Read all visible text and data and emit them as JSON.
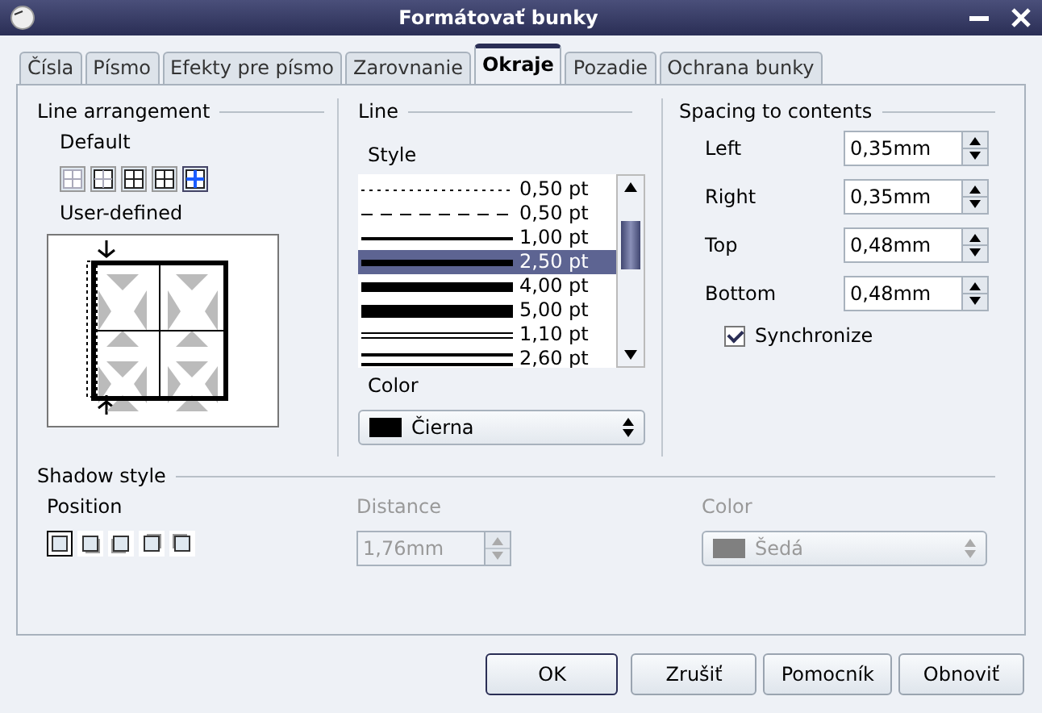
{
  "window": {
    "title": "Formátovať bunky"
  },
  "tabs": [
    {
      "label": "Čísla",
      "selected": false
    },
    {
      "label": "Písmo",
      "selected": false
    },
    {
      "label": "Efekty pre písmo",
      "selected": false
    },
    {
      "label": "Zarovnanie",
      "selected": false
    },
    {
      "label": "Okraje",
      "selected": true
    },
    {
      "label": "Pozadie",
      "selected": false
    },
    {
      "label": "Ochrana bunky",
      "selected": false
    }
  ],
  "line_arrangement": {
    "title": "Line arrangement",
    "default_label": "Default",
    "presets": [
      {
        "selected": false
      },
      {
        "selected": false
      },
      {
        "selected": false
      },
      {
        "selected": false
      },
      {
        "selected": true
      }
    ],
    "user_defined_label": "User-defined"
  },
  "line": {
    "title": "Line",
    "style_label": "Style",
    "styles": [
      {
        "kind": "dotted",
        "label": "0,50 pt",
        "selected": false
      },
      {
        "kind": "dashed",
        "label": "0,50 pt",
        "selected": false
      },
      {
        "kind": "thin",
        "label": "1,00 pt",
        "selected": false
      },
      {
        "kind": "medium",
        "label": "2,50 pt",
        "selected": true
      },
      {
        "kind": "thick",
        "label": "4,00 pt",
        "selected": false
      },
      {
        "kind": "heavy",
        "label": "5,00 pt",
        "selected": false
      },
      {
        "kind": "double",
        "label": "1,10 pt",
        "selected": false
      },
      {
        "kind": "double-thick",
        "label": "2,60 pt",
        "selected": false
      }
    ],
    "color_label": "Color",
    "color": {
      "value": "Čierna",
      "color": "#000000"
    }
  },
  "spacing": {
    "title": "Spacing to contents",
    "fields": [
      {
        "label": "Left",
        "value": "0,35mm"
      },
      {
        "label": "Right",
        "value": "0,35mm"
      },
      {
        "label": "Top",
        "value": "0,48mm"
      },
      {
        "label": "Bottom",
        "value": "0,48mm"
      }
    ],
    "synchronize": {
      "label": "Synchronize",
      "checked": true
    }
  },
  "shadow": {
    "title": "Shadow style",
    "position_label": "Position",
    "positions": [
      {
        "selected": true
      },
      {
        "selected": false
      },
      {
        "selected": false
      },
      {
        "selected": false
      },
      {
        "selected": false
      }
    ],
    "distance_label": "Distance",
    "distance": {
      "value": "1,76mm",
      "disabled": true
    },
    "color_label": "Color",
    "color": {
      "value": "Šedá",
      "color": "#808080",
      "disabled": true
    }
  },
  "buttons": [
    {
      "label": "OK",
      "default": true
    },
    {
      "label": "Zrušiť",
      "default": false
    },
    {
      "label": "Pomocník",
      "default": false
    },
    {
      "label": "Obnoviť",
      "default": false
    }
  ]
}
